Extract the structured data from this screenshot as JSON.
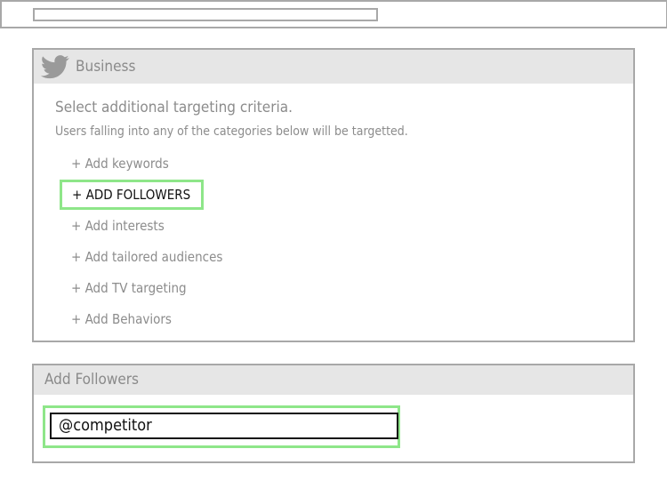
{
  "topbar": {
    "search_value": ""
  },
  "business_panel": {
    "title": "Business",
    "icon": "twitter-bird-icon",
    "intro": "Select additional targeting criteria.",
    "subtext": "Users falling into any of the categories below will be targetted.",
    "criteria": [
      {
        "label": "+ Add keywords",
        "selected": false
      },
      {
        "label": "+ ADD FOLLOWERS",
        "selected": true
      },
      {
        "label": "+ Add interests",
        "selected": false
      },
      {
        "label": "+ Add tailored audiences",
        "selected": false
      },
      {
        "label": "+ Add TV targeting",
        "selected": false
      },
      {
        "label": "+ Add Behaviors",
        "selected": false
      }
    ]
  },
  "followers_panel": {
    "title": "Add Followers",
    "input_value": "@competitor"
  },
  "colors": {
    "border": "#a8a8a8",
    "header_bg": "#e6e6e6",
    "muted_text": "#8c8c8c",
    "highlight": "#8ee689",
    "strong_text": "#111111"
  }
}
